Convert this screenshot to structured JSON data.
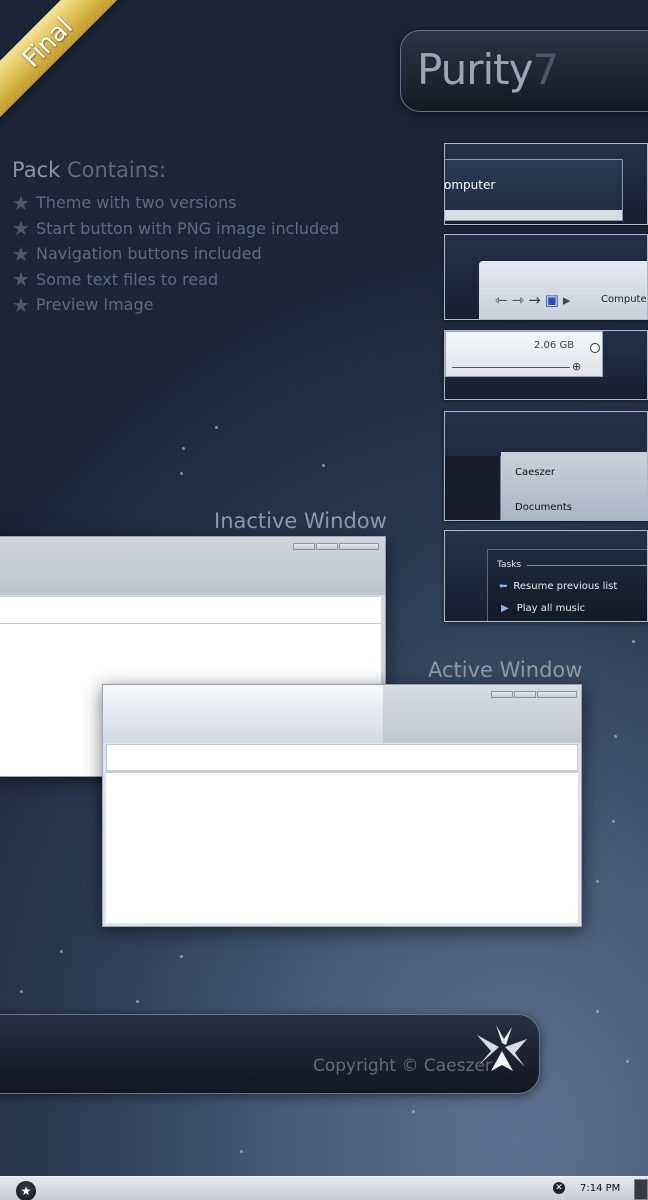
{
  "ribbon": {
    "label": "Final"
  },
  "title": {
    "main": "Purity",
    "suffix": "7"
  },
  "pack": {
    "heading_a": "Pack",
    "heading_b": "Contains:",
    "items": [
      "Theme with two versions",
      "Start button with PNG image included",
      "Navigation buttons included",
      "Some text files to read",
      "Preview Image"
    ]
  },
  "thumbs": {
    "computer_label": "omputer",
    "nav_label": "Computer",
    "nav_arrows": [
      "⇽",
      "⇾",
      "→",
      "▸"
    ],
    "disk_size": "2.06 GB",
    "nav_items": [
      "Caeszer",
      "Documents"
    ],
    "tasks_header": "Tasks",
    "task_resume": "Resume previous list",
    "task_play": "Play all music"
  },
  "labels": {
    "inactive": "Inactive Window",
    "active": "Active Window"
  },
  "footer": {
    "copyright": "Copyright © Caeszer"
  },
  "taskbar": {
    "time": "7:14 PM"
  },
  "colors": {
    "accent": "#88b2e8",
    "ribbon": "#d9b84a",
    "background": "#2a3850"
  }
}
